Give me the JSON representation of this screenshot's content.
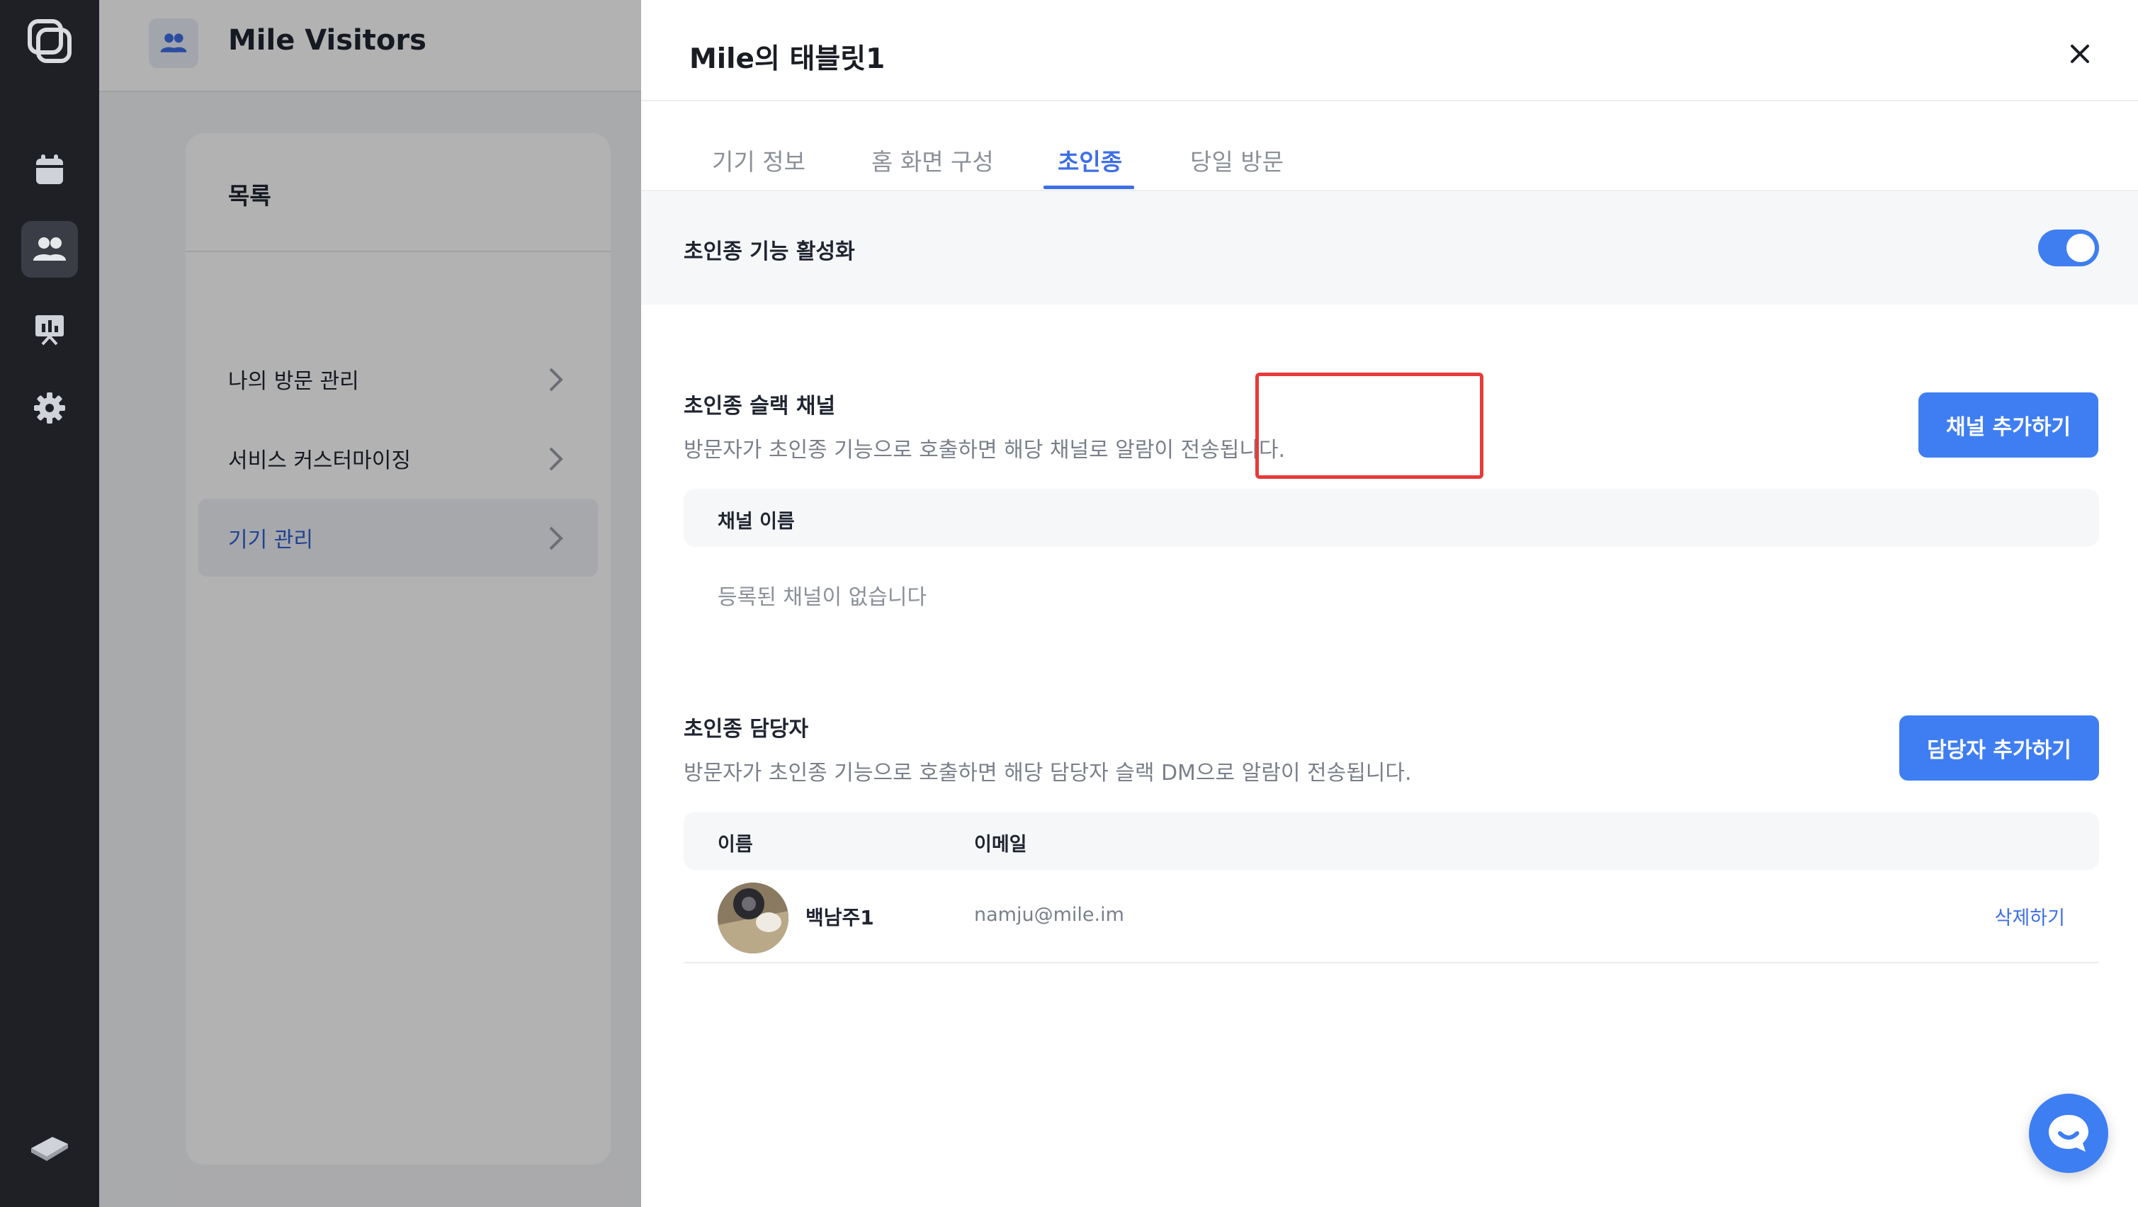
{
  "app": {
    "title": "Mile Visitors",
    "rail_icons": [
      "app-logo-icon",
      "calendar-icon",
      "users-icon",
      "presentation-icon",
      "gear-icon",
      "book-icon"
    ],
    "active_rail": "users-icon"
  },
  "sidebar": {
    "title": "목록",
    "items": [
      {
        "label": "나의 방문 관리",
        "active": false
      },
      {
        "label": "서비스 커스터마이징",
        "active": false
      },
      {
        "label": "기기 관리",
        "active": true
      }
    ]
  },
  "drawer": {
    "title": "Mile의 태블릿1",
    "tabs": [
      {
        "label": "기기 정보",
        "active": false
      },
      {
        "label": "홈 화면 구성",
        "active": false
      },
      {
        "label": "초인종",
        "active": true
      },
      {
        "label": "당일 방문",
        "active": false
      }
    ],
    "toggle": {
      "label": "초인종 기능 활성화",
      "enabled": true
    },
    "channel_section": {
      "title": "초인종 슬랙 채널",
      "description": "방문자가 초인종 기능으로 호출하면 해당 채널로 알람이 전송됩니다.",
      "add_button": "채널 추가하기",
      "column_header": "채널 이름",
      "empty_message": "등록된 채널이 없습니다"
    },
    "manager_section": {
      "title": "초인종 담당자",
      "description": "방문자가 초인종 기능으로 호출하면 해당 담당자 슬랙 DM으로 알람이 전송됩니다.",
      "add_button": "담당자 추가하기",
      "columns": [
        "이름",
        "이메일"
      ],
      "rows": [
        {
          "name": "백남주1",
          "email": "namju@mile.im",
          "action": "삭제하기"
        }
      ]
    }
  },
  "colors": {
    "accent": "#3f7ef2",
    "highlight": "#e83a3a",
    "rail": "#1e2025"
  }
}
